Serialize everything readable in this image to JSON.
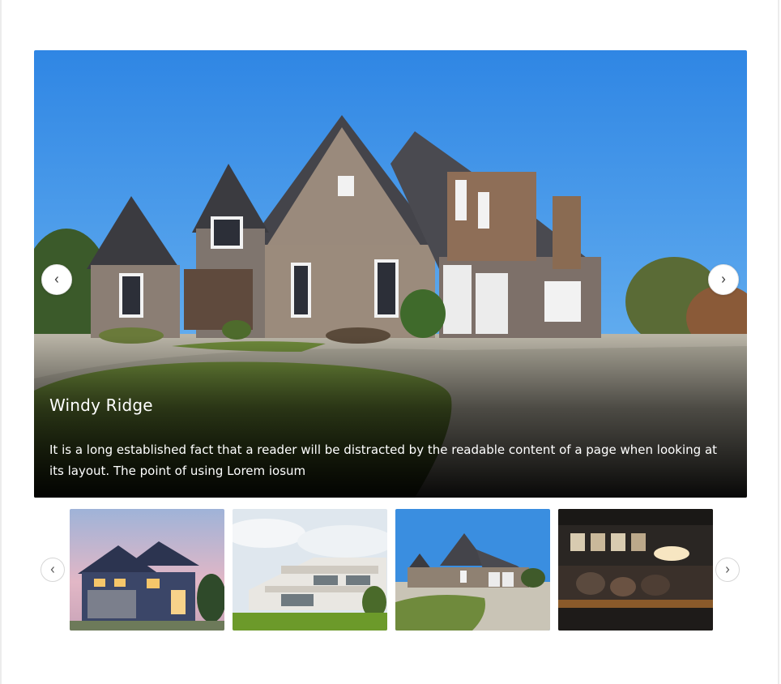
{
  "slide": {
    "title": "Windy Ridge",
    "description": "It is a long established fact that a reader will be distracted by the readable content of a page when looking at its layout. The point of using Lorem iosum"
  },
  "controls": {
    "prev_icon": "chevron-left-icon",
    "next_icon": "chevron-right-icon"
  },
  "thumbnails": [
    {
      "name": "blue-house-dusk"
    },
    {
      "name": "white-modern-house"
    },
    {
      "name": "brick-house-driveway"
    },
    {
      "name": "restaurant-interior"
    }
  ],
  "colors": {
    "sky": "#3d8fe0",
    "caption_text": "#ffffff",
    "button_bg": "#ffffff"
  }
}
